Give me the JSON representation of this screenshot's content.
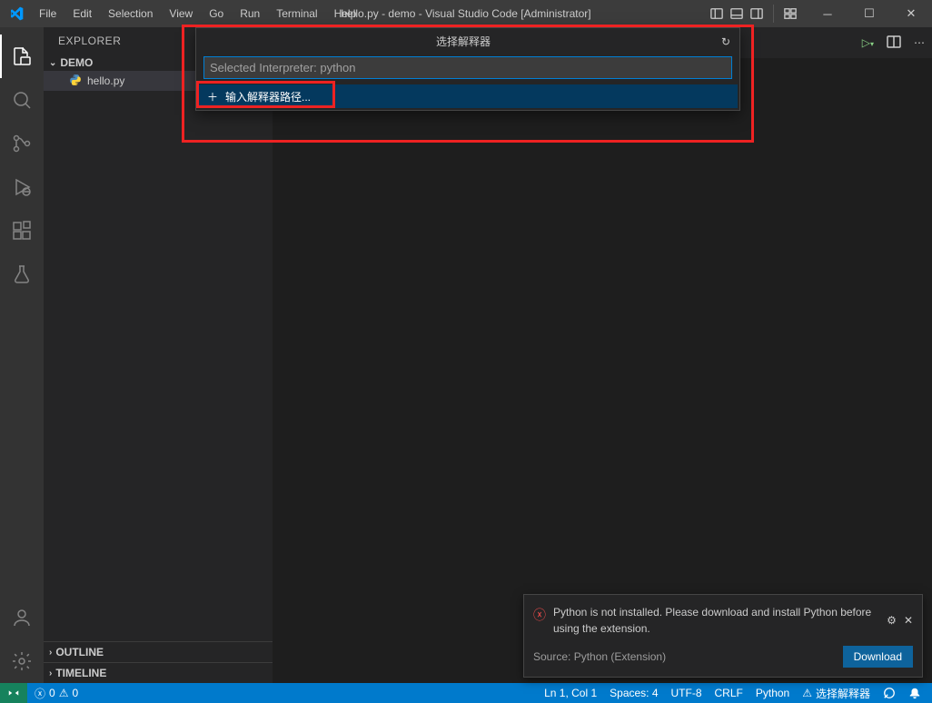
{
  "titlebar": {
    "menus": [
      "File",
      "Edit",
      "Selection",
      "View",
      "Go",
      "Run",
      "Terminal",
      "Help"
    ],
    "title": "hello.py - demo - Visual Studio Code [Administrator]"
  },
  "sidebar": {
    "title": "EXPLORER",
    "project": "DEMO",
    "file": "hello.py",
    "outline": "OUTLINE",
    "timeline": "TIMELINE"
  },
  "quickpick": {
    "title": "选择解释器",
    "placeholder": "Selected Interpreter: python",
    "option": "输入解释器路径..."
  },
  "notification": {
    "message": "Python is not installed. Please download and install Python before using the extension.",
    "source": "Source: Python (Extension)",
    "download": "Download"
  },
  "statusbar": {
    "errors": "0",
    "warnings": "0",
    "position": "Ln 1, Col 1",
    "spaces": "Spaces: 4",
    "encoding": "UTF-8",
    "eol": "CRLF",
    "language": "Python",
    "interpreter": "选择解释器"
  }
}
